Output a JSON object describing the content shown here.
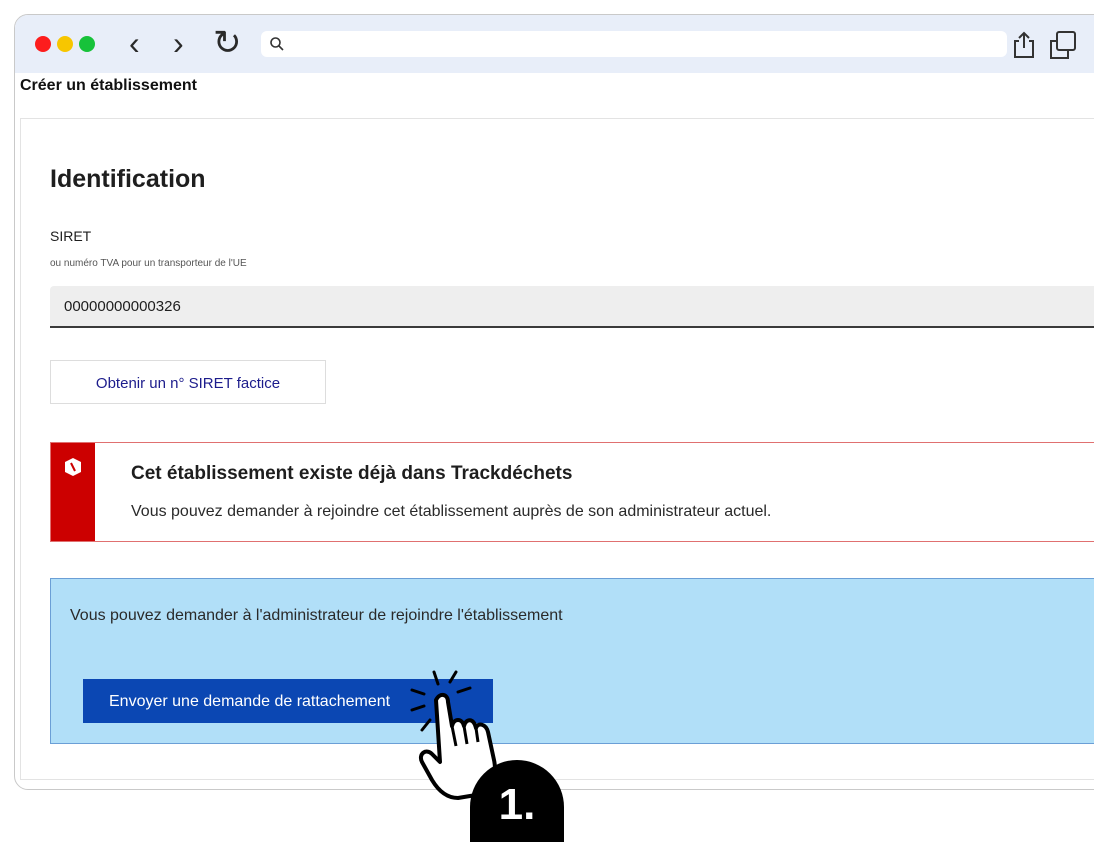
{
  "browser": {
    "controls": [
      "close",
      "minimize",
      "maximize"
    ],
    "icons": {
      "back": "chevron-left-icon",
      "forward": "chevron-right-icon",
      "reload": "reload-icon",
      "search": "search-icon",
      "share": "share-icon",
      "tabs": "tabs-icon"
    },
    "url": ""
  },
  "page": {
    "title": "Créer un établissement"
  },
  "form": {
    "section_title": "Identification",
    "siret_label": "SIRET",
    "siret_hint": "ou numéro TVA pour un transporteur de l'UE",
    "siret_value": "00000000000326",
    "fake_siret_button": "Obtenir un n° SIRET factice"
  },
  "alert": {
    "title": "Cet établissement existe déjà dans Trackdéchets",
    "text": "Vous pouvez demander à rejoindre cet établissement auprès de son administrateur actuel.",
    "color": "#cc0000"
  },
  "info": {
    "text": "Vous pouvez demander à l'administrateur de rejoindre l'établissement",
    "button": "Envoyer une demande de rattachement",
    "background": "#b1dff8",
    "button_color": "#0b47b3"
  },
  "annotation": {
    "step": "1."
  }
}
